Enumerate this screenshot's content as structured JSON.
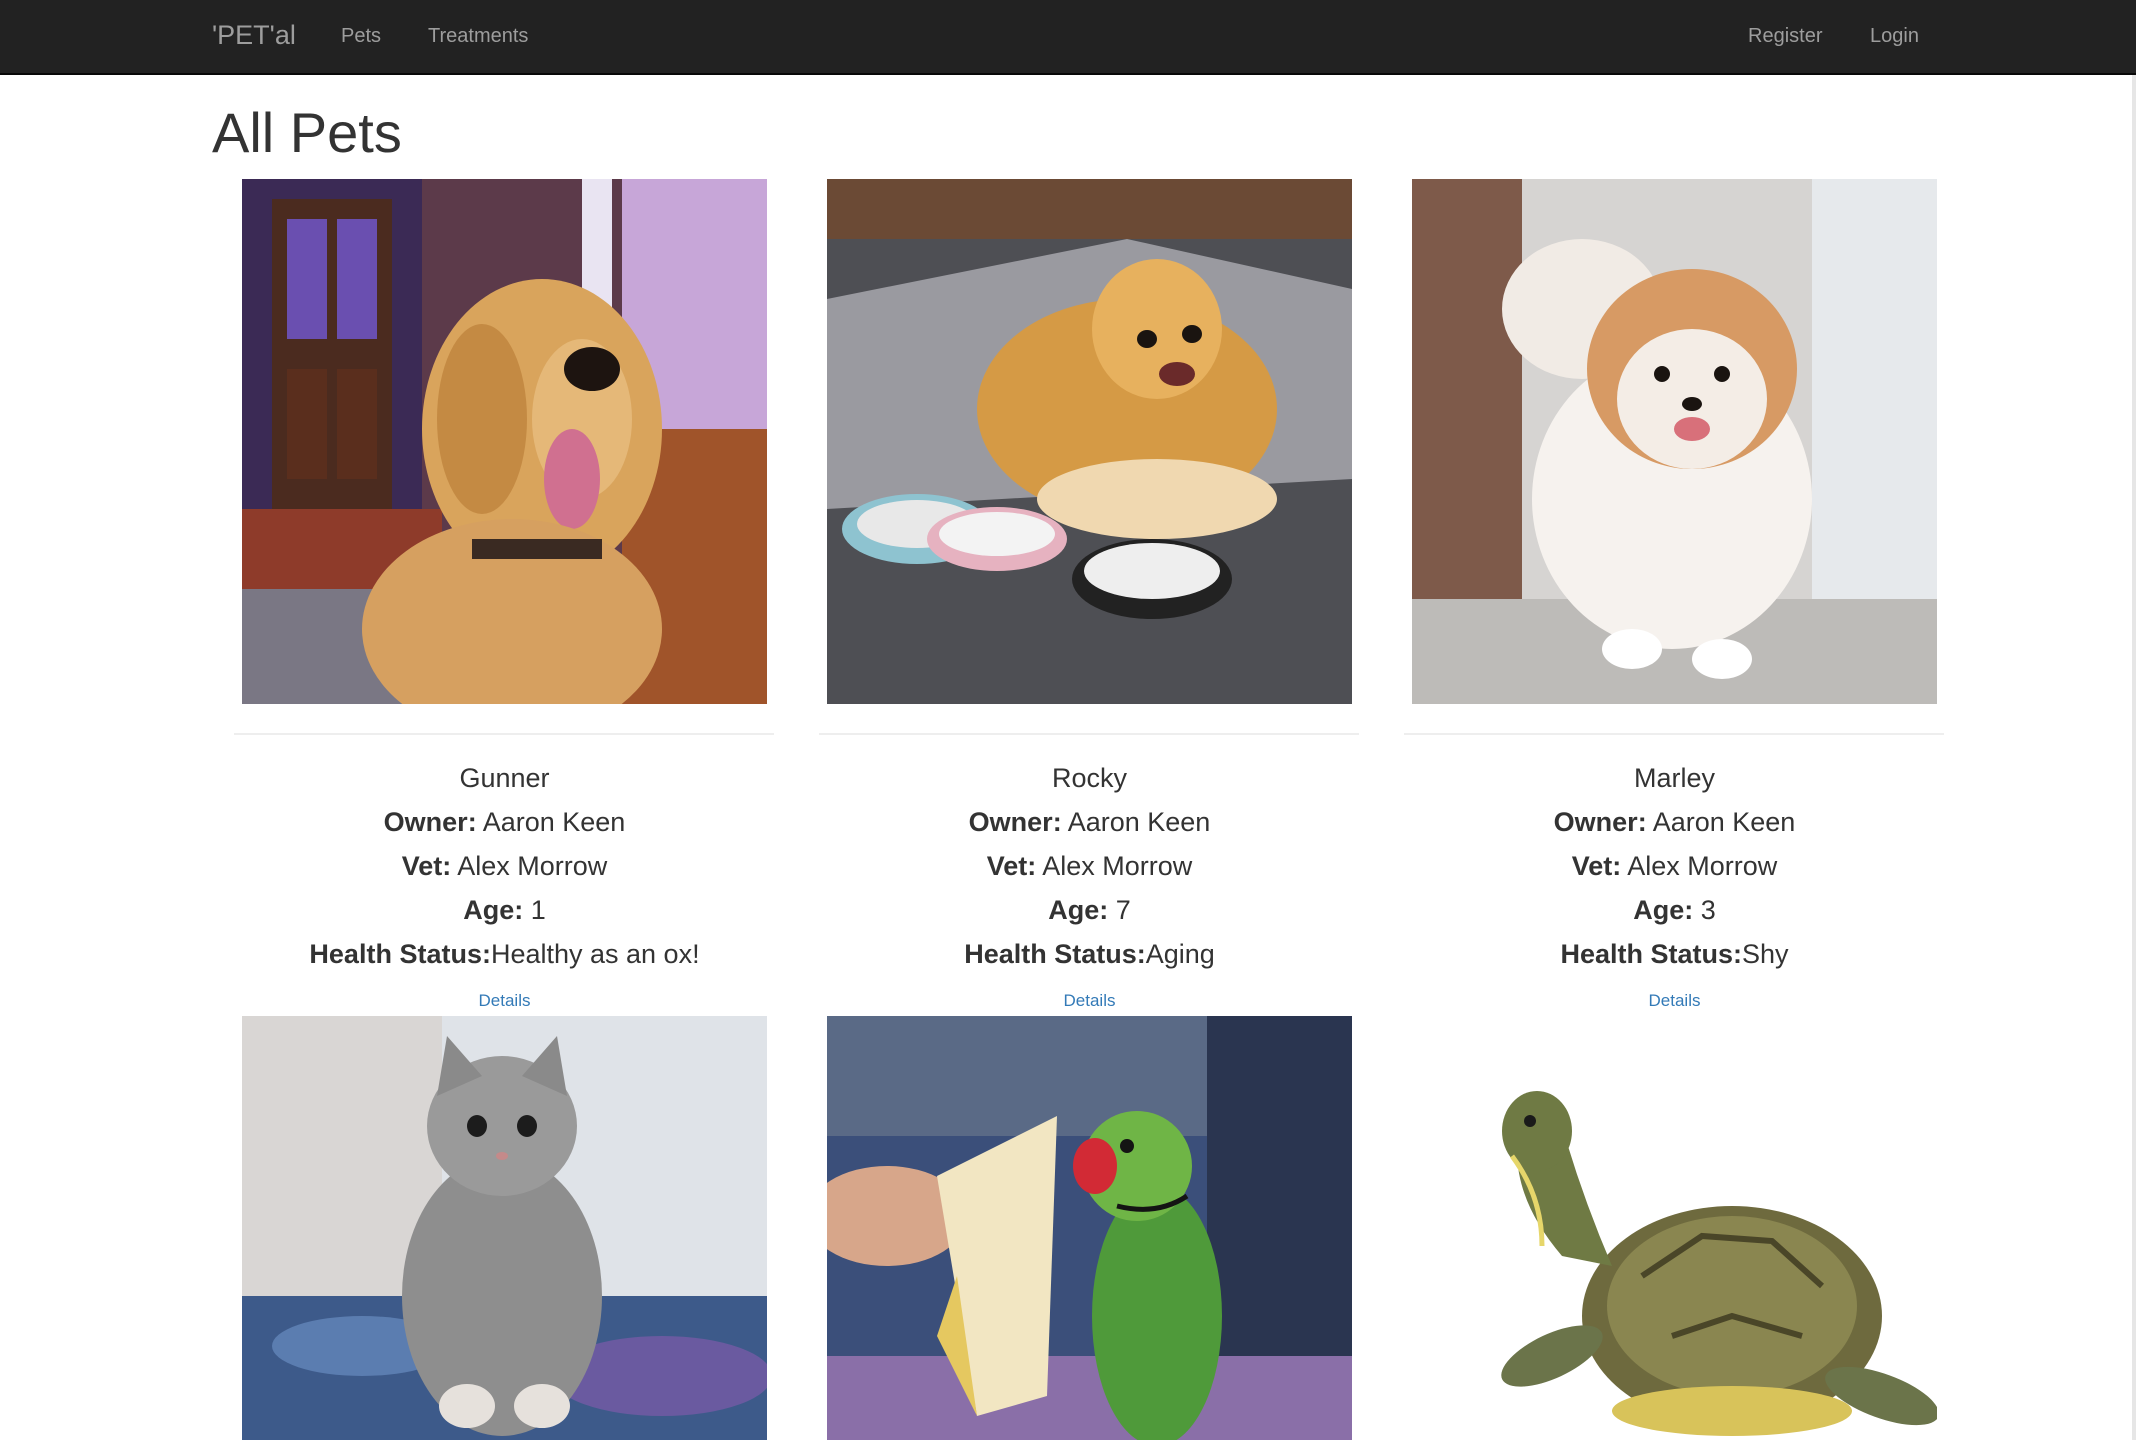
{
  "nav": {
    "brand": "'PET'al",
    "links": [
      "Pets",
      "Treatments"
    ],
    "register": "Register",
    "login": "Login"
  },
  "page": {
    "title": "All Pets"
  },
  "pets": [
    {
      "name": "Gunner",
      "owner_label": "Owner:",
      "owner": "Aaron Keen",
      "vet_label": "Vet:",
      "vet": "Alex Morrow",
      "age_label": "Age:",
      "age": "1",
      "health_label": "Health Status:",
      "health": "Healthy as an ox!",
      "details": "Details",
      "photo_icon": "golden-retriever-photo"
    },
    {
      "name": "Rocky",
      "owner_label": "Owner:",
      "owner": "Aaron Keen",
      "vet_label": "Vet:",
      "vet": "Alex Morrow",
      "age_label": "Age:",
      "age": "7",
      "health_label": "Health Status:",
      "health": "Aging",
      "details": "Details",
      "photo_icon": "pomeranian-with-bowls-photo"
    },
    {
      "name": "Marley",
      "owner_label": "Owner:",
      "owner": "Aaron Keen",
      "vet_label": "Vet:",
      "vet": "Alex Morrow",
      "age_label": "Age:",
      "age": "3",
      "health_label": "Health Status:",
      "health": "Shy",
      "details": "Details",
      "photo_icon": "white-pomeranian-photo"
    },
    {
      "photo_icon": "tabby-kitten-photo"
    },
    {
      "photo_icon": "parrot-with-banana-photo"
    },
    {
      "photo_icon": "turtle-photo"
    }
  ],
  "colors": {
    "navbar": "#222222",
    "nav_text": "#9d9d9d",
    "link": "#337ab7",
    "text": "#333333"
  }
}
